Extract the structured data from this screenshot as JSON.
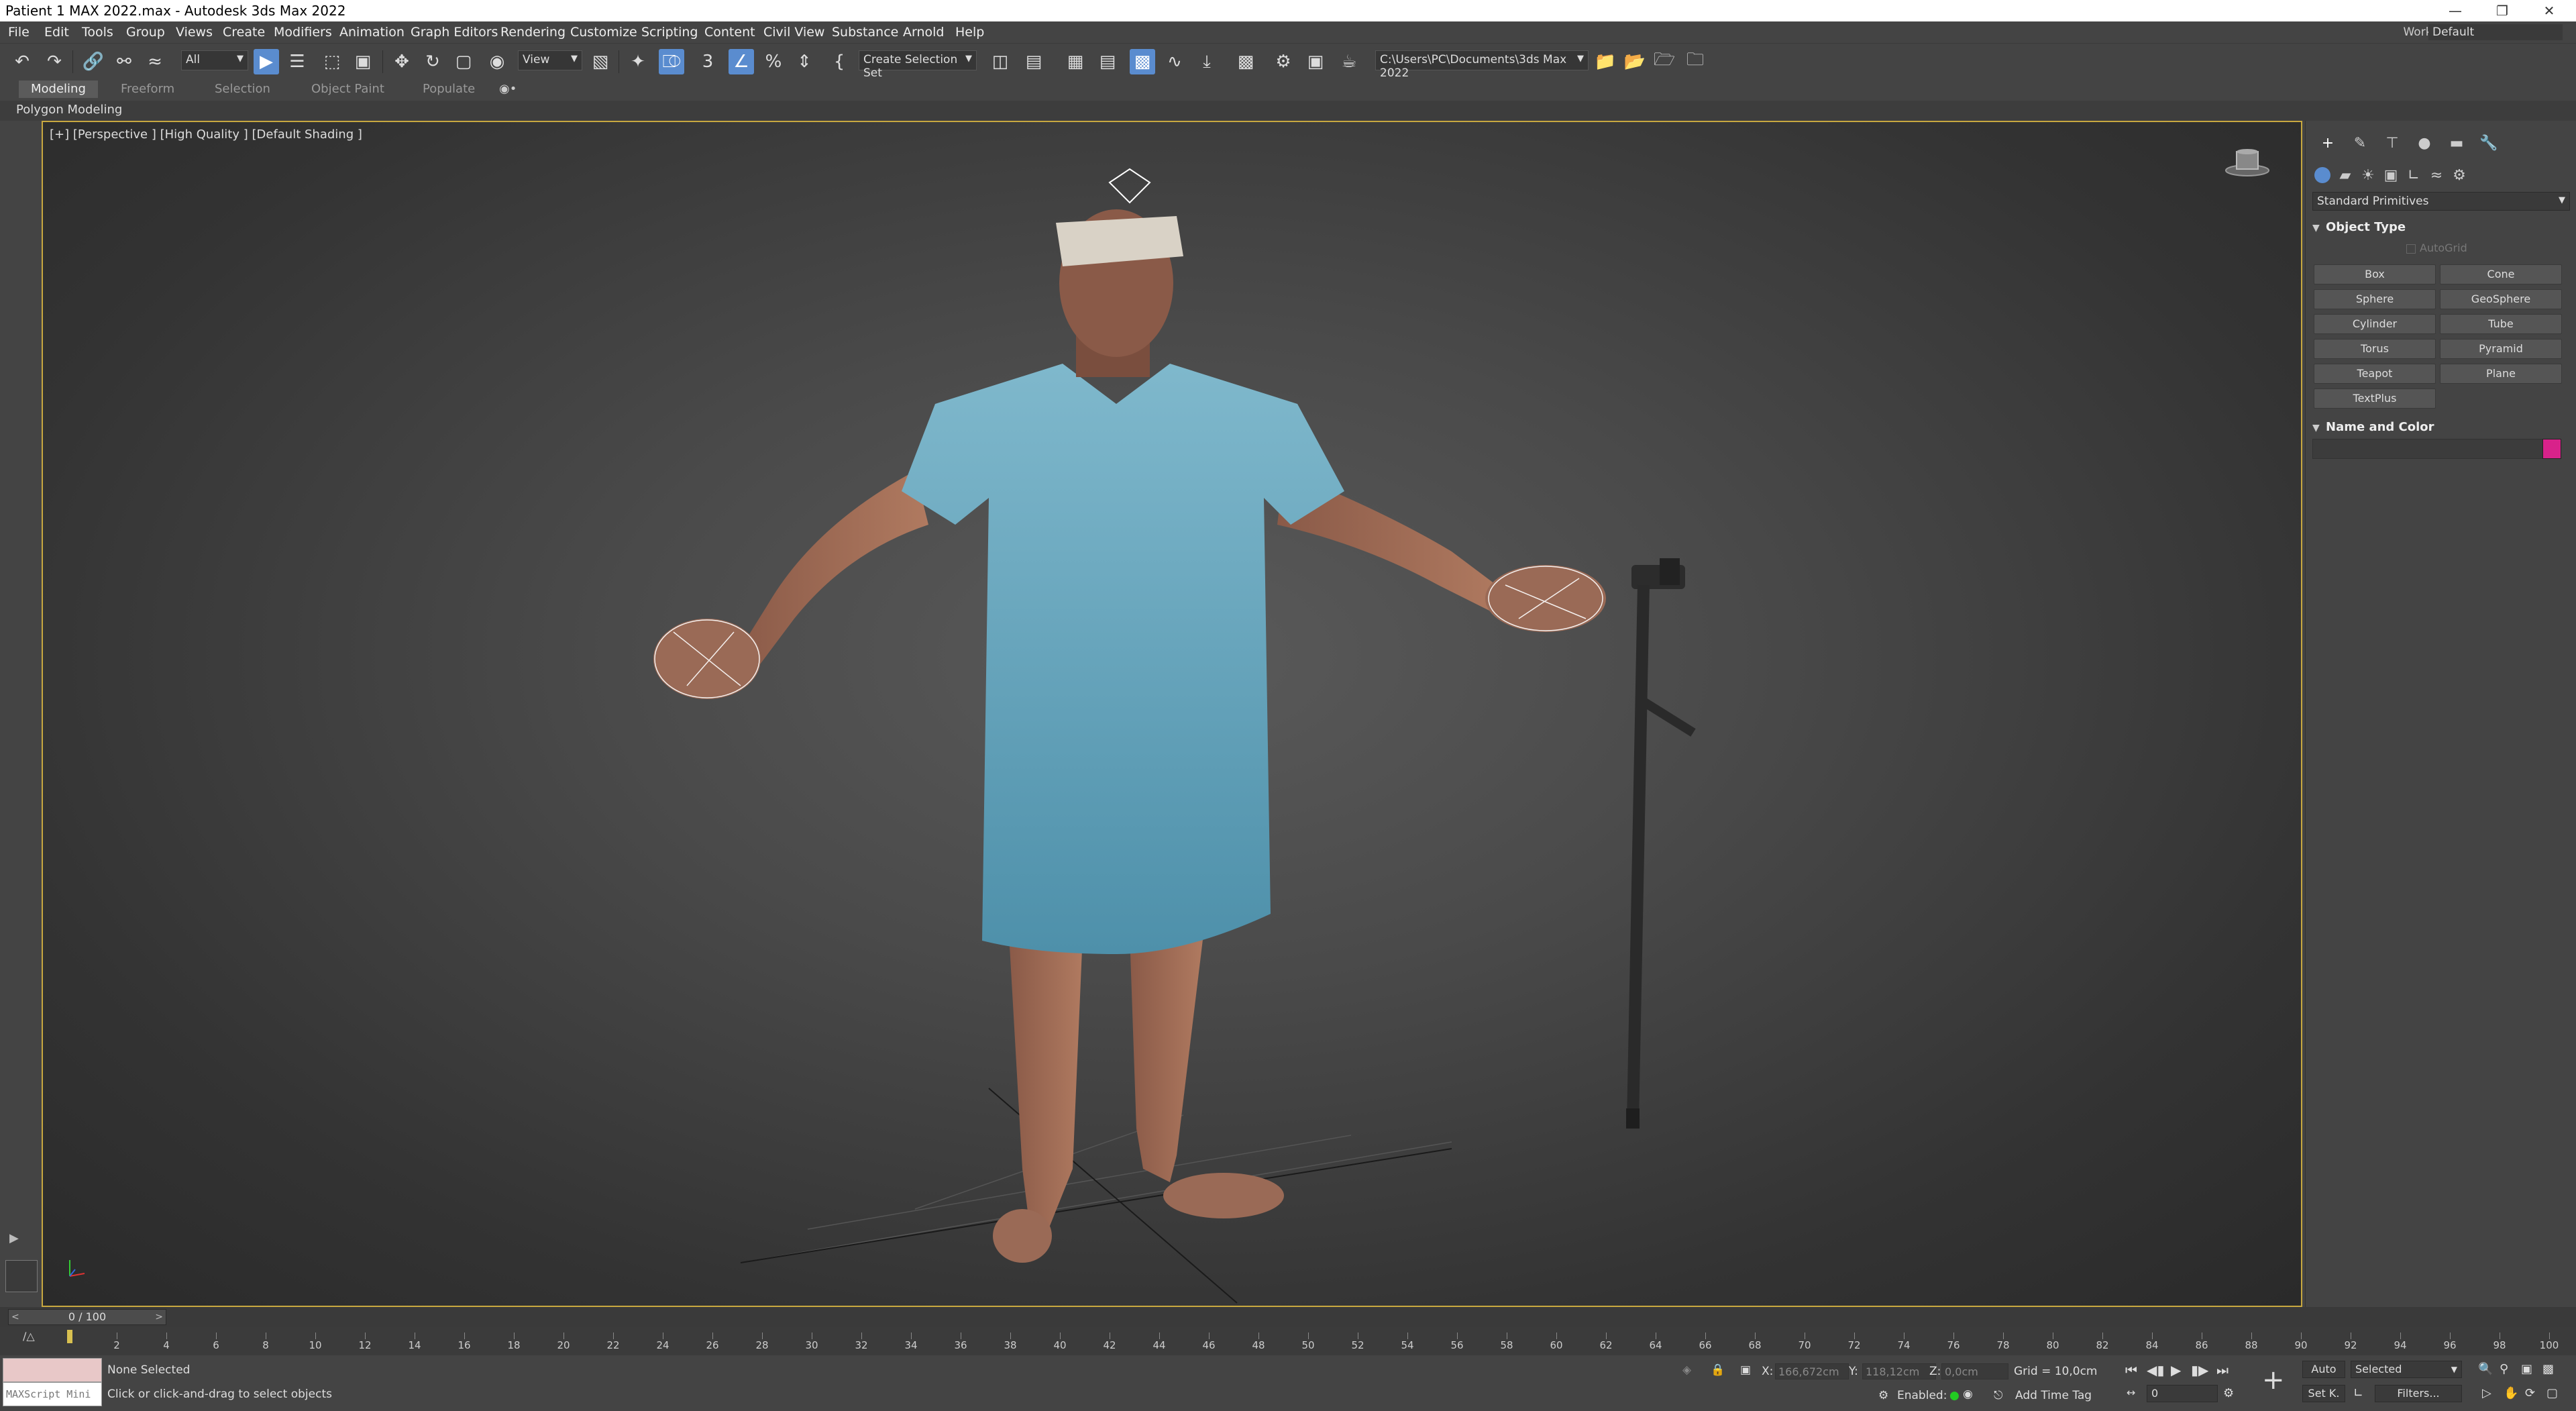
{
  "window": {
    "title": "Patient 1 MAX 2022.max - Autodesk 3ds Max 2022",
    "controls": [
      "minimize",
      "restore",
      "close"
    ]
  },
  "menu": {
    "items": [
      "File",
      "Edit",
      "Tools",
      "Group",
      "Views",
      "Create",
      "Modifiers",
      "Animation",
      "Graph Editors",
      "Rendering",
      "Customize",
      "Scripting",
      "Content",
      "Civil View",
      "Substance",
      "Arnold",
      "Help"
    ],
    "workspaces_label": "Workspaces:",
    "workspaces_value": "Default"
  },
  "toolbar": {
    "selection_filter": "All",
    "reference_coord": "View",
    "named_selection": "Create Selection Set",
    "project_path": "C:\\Users\\PC\\Documents\\3ds Max 2022"
  },
  "ribbon": {
    "tabs": [
      "Modeling",
      "Freeform",
      "Selection",
      "Object Paint",
      "Populate"
    ],
    "active_tab": "Modeling",
    "panel_label": "Polygon Modeling"
  },
  "viewport": {
    "label": "[+] [Perspective ] [High Quality ] [Default Shading ]"
  },
  "command_panel": {
    "category_dropdown": "Standard Primitives",
    "object_type_title": "Object Type",
    "autogrid_label": "AutoGrid",
    "primitives": [
      "Box",
      "Cone",
      "Sphere",
      "GeoSphere",
      "Cylinder",
      "Tube",
      "Torus",
      "Pyramid",
      "Teapot",
      "Plane",
      "TextPlus"
    ],
    "name_color_title": "Name and Color",
    "object_color": "#d8228a"
  },
  "timeline": {
    "frame_display": "0 / 100",
    "ticks": [
      0,
      2,
      4,
      6,
      8,
      10,
      12,
      14,
      16,
      18,
      20,
      22,
      24,
      26,
      28,
      30,
      32,
      34,
      36,
      38,
      40,
      42,
      44,
      46,
      48,
      50,
      52,
      54,
      56,
      58,
      60,
      62,
      64,
      66,
      68,
      70,
      72,
      74,
      76,
      78,
      80,
      82,
      84,
      86,
      88,
      90,
      92,
      94,
      96,
      98,
      100
    ],
    "tick_labels": [
      "2",
      "4",
      "6",
      "8",
      "10",
      "12",
      "14",
      "16",
      "18",
      "20",
      "22",
      "24",
      "26",
      "28",
      "30",
      "32",
      "34",
      "36",
      "38",
      "40",
      "42",
      "44",
      "46",
      "48",
      "50",
      "52",
      "54",
      "56",
      "58",
      "60",
      "62",
      "64",
      "66",
      "68",
      "70",
      "72",
      "74",
      "76",
      "78",
      "80",
      "82",
      "84",
      "86",
      "88",
      "90",
      "92",
      "94",
      "96",
      "98",
      "100"
    ]
  },
  "status": {
    "maxscript_label": "MAXScript Mini",
    "selection_status": "None Selected",
    "prompt": "Click or click-and-drag to select objects",
    "x_label": "X:",
    "x_value": "166,672cm",
    "y_label": "Y:",
    "y_value": "118,12cm",
    "z_label": "Z:",
    "z_value": "0,0cm",
    "grid": "Grid = 10,0cm",
    "enabled_label": "Enabled:",
    "add_time_tag": "Add Time Tag",
    "auto_label": "Auto",
    "set_key_label": "Set K.",
    "key_filter": "Selected",
    "filters_label": "Filters...",
    "current_frame": "0"
  }
}
